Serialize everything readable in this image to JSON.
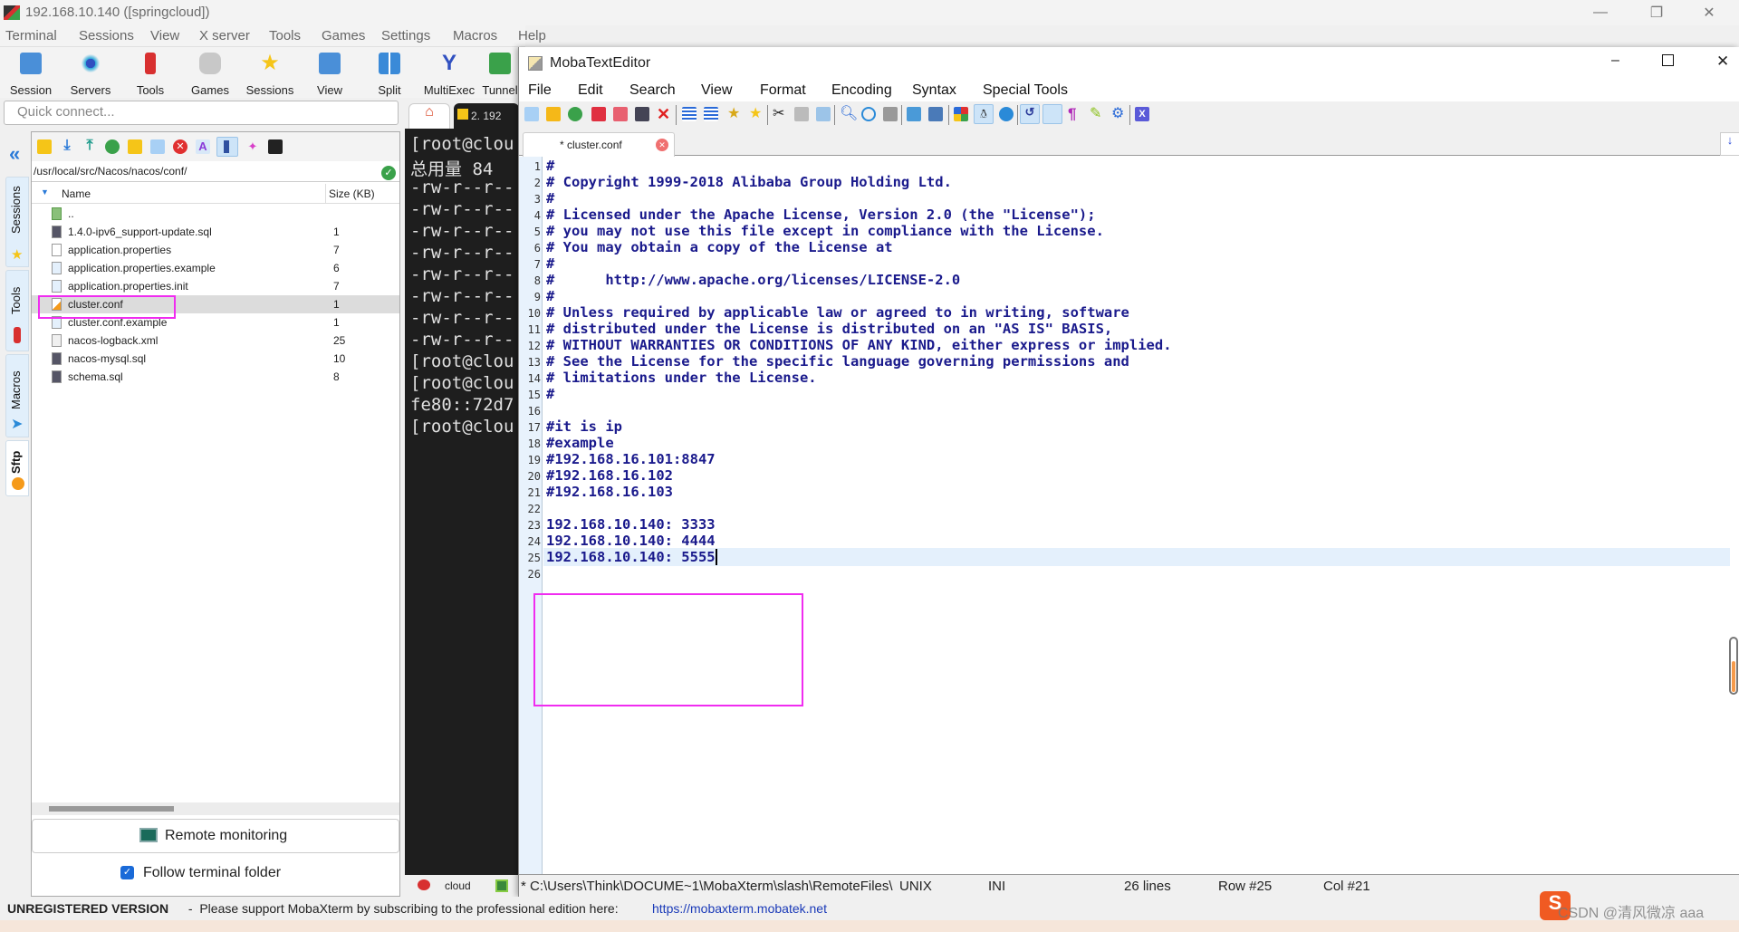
{
  "window": {
    "title": "192.168.10.140 ([springcloud])"
  },
  "menu": [
    "Terminal",
    "Sessions",
    "View",
    "X server",
    "Tools",
    "Games",
    "Settings",
    "Macros",
    "Help"
  ],
  "toolbar": [
    {
      "label": "Session",
      "icon": "session-icon",
      "color": "#4a8fd8"
    },
    {
      "label": "Servers",
      "icon": "servers-icon",
      "color": "#2aa8d8"
    },
    {
      "label": "Tools",
      "icon": "tools-icon",
      "color": "#d83030"
    },
    {
      "label": "Games",
      "icon": "games-icon",
      "color": "#b0b0b0"
    },
    {
      "label": "Sessions",
      "icon": "star-icon",
      "color": "#f5c518"
    },
    {
      "label": "View",
      "icon": "view-icon",
      "color": "#4a8fd8"
    },
    {
      "label": "Split",
      "icon": "split-icon",
      "color": "#3a8ad8"
    },
    {
      "label": "MultiExec",
      "icon": "multiexec-icon",
      "color": "#3050c0"
    },
    {
      "label": "Tunnel",
      "icon": "tunnel-icon",
      "color": "#3aa14a"
    }
  ],
  "quick_connect": {
    "placeholder": "Quick connect..."
  },
  "side_tabs": [
    "Sessions",
    "Tools",
    "Macros",
    "Sftp"
  ],
  "sftp": {
    "path": "/usr/local/src/Nacos/nacos/conf/",
    "columns": {
      "name": "Name",
      "size": "Size (KB)"
    },
    "files": [
      {
        "name": "..",
        "size": "",
        "type": "parent-folder"
      },
      {
        "name": "1.4.0-ipv6_support-update.sql",
        "size": "1",
        "type": "sql"
      },
      {
        "name": "application.properties",
        "size": "7",
        "type": "file"
      },
      {
        "name": "application.properties.example",
        "size": "6",
        "type": "file"
      },
      {
        "name": "application.properties.init",
        "size": "7",
        "type": "file"
      },
      {
        "name": "cluster.conf",
        "size": "1",
        "type": "edited",
        "selected": true
      },
      {
        "name": "cluster.conf.example",
        "size": "1",
        "type": "file"
      },
      {
        "name": "nacos-logback.xml",
        "size": "25",
        "type": "file"
      },
      {
        "name": "nacos-mysql.sql",
        "size": "10",
        "type": "sql"
      },
      {
        "name": "schema.sql",
        "size": "8",
        "type": "sql"
      }
    ],
    "remote_monitoring": "Remote monitoring",
    "follow_terminal": {
      "label": "Follow terminal folder",
      "checked": true
    }
  },
  "terminal": {
    "tab_label": "2. 192",
    "lines": [
      "[root@clou",
      "总用量 84",
      "-rw-r--r--",
      "-rw-r--r--",
      "-rw-r--r--",
      "-rw-r--r--",
      "-rw-r--r--",
      "-rw-r--r--",
      "-rw-r--r--",
      "-rw-r--r--",
      "[root@clou",
      "[root@clou",
      "fe80::72d7",
      "[root@clou"
    ],
    "status_label": "cloud"
  },
  "editor": {
    "title": "MobaTextEditor",
    "menu": [
      "File",
      "Edit",
      "Search",
      "View",
      "Format",
      "Encoding",
      "Syntax",
      "Special Tools"
    ],
    "tab_label": "* cluster.conf",
    "lines": [
      "#",
      "# Copyright 1999-2018 Alibaba Group Holding Ltd.",
      "#",
      "# Licensed under the Apache License, Version 2.0 (the \"License\");",
      "# you may not use this file except in compliance with the License.",
      "# You may obtain a copy of the License at",
      "#",
      "#      http://www.apache.org/licenses/LICENSE-2.0",
      "#",
      "# Unless required by applicable law or agreed to in writing, software",
      "# distributed under the License is distributed on an \"AS IS\" BASIS,",
      "# WITHOUT WARRANTIES OR CONDITIONS OF ANY KIND, either express or implied.",
      "# See the License for the specific language governing permissions and",
      "# limitations under the License.",
      "#",
      "",
      "#it is ip",
      "#example",
      "#192.168.16.101:8847",
      "#192.168.16.102",
      "#192.168.16.103",
      "",
      "192.168.10.140: 3333",
      "192.168.10.140: 4444",
      "192.168.10.140: 5555",
      ""
    ],
    "status": {
      "path": "* C:\\Users\\Think\\DOCUME~1\\MobaXterm\\slash\\RemoteFiles\\",
      "eol": "UNIX",
      "syntax": "INI",
      "line_count": "26 lines",
      "row": "Row #25",
      "col": "Col #21"
    }
  },
  "footer": {
    "unregistered": "UNREGISTERED VERSION",
    "message": " -  Please support MobaXterm by subscribing to the professional edition here: ",
    "link": "https://mobaxterm.mobatek.net"
  },
  "watermark": "CSDN @清风微凉 aaa",
  "colors": {
    "highlight": "#f02cf0",
    "code": "#1a1a8c",
    "gutter": "#e8f2fc"
  }
}
